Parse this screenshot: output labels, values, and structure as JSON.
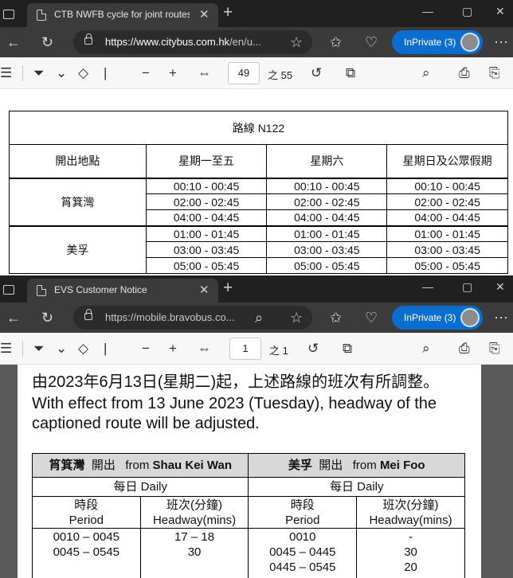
{
  "window1": {
    "tab_title": "CTB NWFB cycle for joint routes...",
    "url_domain": "https://www.citybus.com.hk",
    "url_rest": "/en/u...",
    "inprivate_label": "InPrivate (3)",
    "page_current": "49",
    "page_total": "之 55",
    "table": {
      "title": "路線 N122",
      "headers": [
        "開出地點",
        "星期一至五",
        "星期六",
        "星期日及公眾假期"
      ],
      "groups": [
        {
          "origin": "筲箕灣",
          "rows": [
            [
              "00:10 - 00:45",
              "00:10 - 00:45",
              "00:10 - 00:45"
            ],
            [
              "02:00 - 02:45",
              "02:00 - 02:45",
              "02:00 - 02:45"
            ],
            [
              "04:00 - 04:45",
              "04:00 - 04:45",
              "04:00 - 04:45"
            ]
          ]
        },
        {
          "origin": "美孚",
          "rows": [
            [
              "01:00 - 01:45",
              "01:00 - 01:45",
              "01:00 - 01:45"
            ],
            [
              "03:00 - 03:45",
              "03:00 - 03:45",
              "03:00 - 03:45"
            ],
            [
              "05:00 - 05:45",
              "05:00 - 05:45",
              "05:00 - 05:45"
            ]
          ]
        }
      ]
    }
  },
  "window2": {
    "tab_title": "EVS Customer Notice",
    "url_text": "https://mobile.bravobus.co...",
    "inprivate_label": "InPrivate (3)",
    "page_current": "1",
    "page_total": "之 1",
    "notice_zh": "由2023年6月13日(星期二)起，上述路線的班次有所調整。",
    "notice_en_1": "With effect from 13 June 2023 (Tuesday), headway of the",
    "notice_en_2": "captioned route will be adjusted.",
    "table": {
      "left_header_zh": "筲箕灣",
      "left_header_dep": "開出",
      "left_header_from": "from",
      "left_header_en": "Shau Kei Wan",
      "right_header_zh": "美孚",
      "right_header_dep": "開出",
      "right_header_from": "from",
      "right_header_en": "Mei Foo",
      "daily": "每日  Daily",
      "period_zh": "時段",
      "period_en": "Period",
      "headway_zh": "班次(分鐘)",
      "headway_en": "Headway(mins)",
      "left_periods": [
        "0010 – 0045",
        "0045 – 0545"
      ],
      "left_headways": [
        "17 – 18",
        "30"
      ],
      "right_periods": [
        "0010",
        "0045 – 0445",
        "0445 – 0545"
      ],
      "right_headways": [
        "-",
        "30",
        "20"
      ]
    }
  },
  "colors": {
    "inprivate_blue": "#0a6ed1",
    "chrome_dark": "#202020",
    "toolbar_dark": "#3b3b3b",
    "table_header_gray": "#d8d8d8"
  }
}
